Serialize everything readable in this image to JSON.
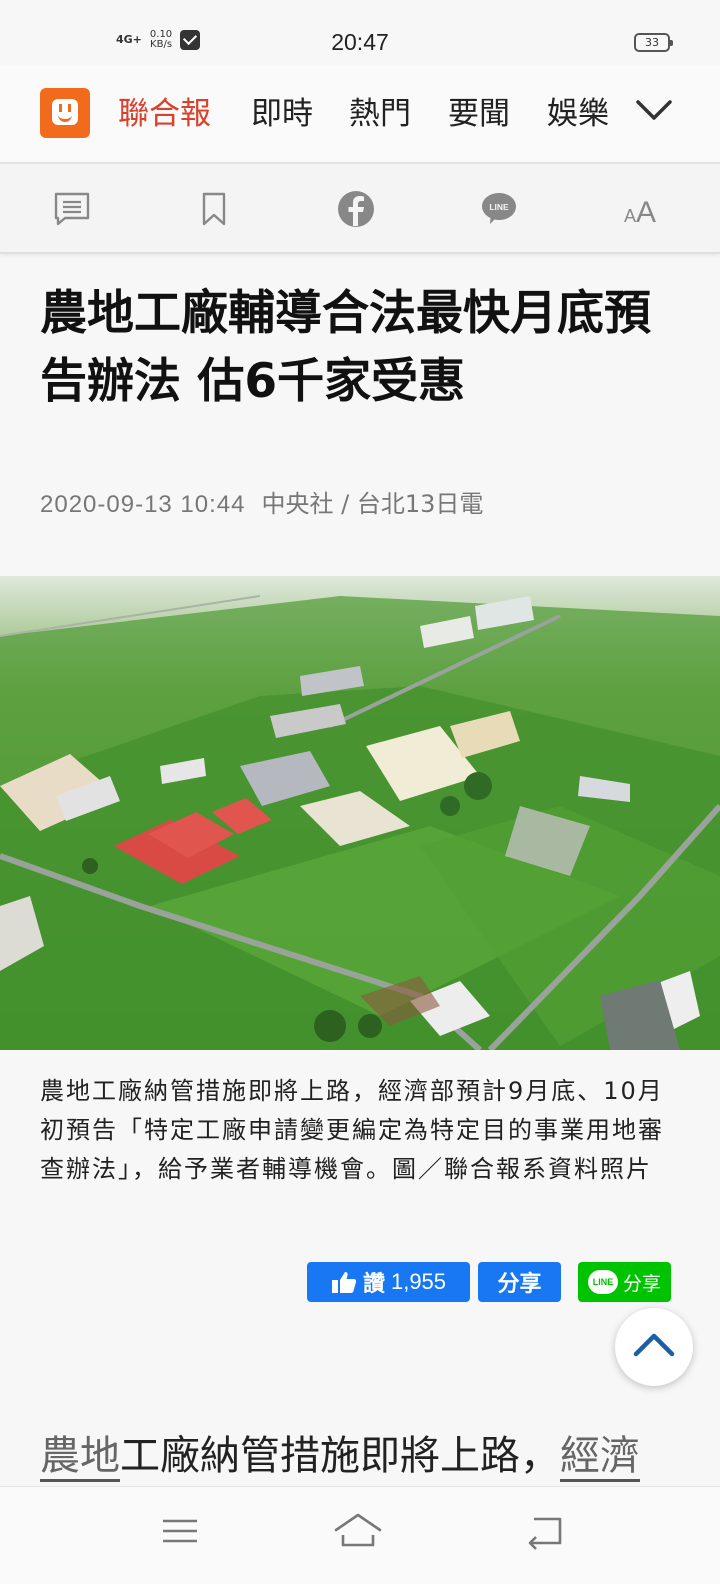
{
  "status_bar": {
    "network": "4G+",
    "speed_value": "0.10",
    "speed_unit": "KB/s",
    "time": "20:47",
    "battery": "33"
  },
  "nav": {
    "brand": "聯合報",
    "items": [
      "即時",
      "熱門",
      "要聞",
      "娛樂"
    ],
    "active_color": "#d9412c",
    "logo_color": "#f26b1d"
  },
  "toolbar": {
    "icons": [
      "comment-icon",
      "bookmark-icon",
      "facebook-icon",
      "line-icon",
      "font-size-icon"
    ],
    "line_label": "LINE",
    "font_label_small": "A",
    "font_label_large": "A"
  },
  "article": {
    "title": "農地工廠輔導合法最快月底預告辦法 估6千家受惠",
    "date": "2020-09-13 10:44",
    "source": "中央社 / 台北13日電",
    "caption": "農地工廠納管措施即將上路，經濟部預計9月底、10月初預告「特定工廠申請變更編定為特定目的事業用地審查辦法」，給予業者輔導機會。圖／聯合報系資料照片",
    "body_first_underlined": "農地",
    "body_middle": "工廠納管措施即將上路，",
    "body_last_underlined": "經濟"
  },
  "share": {
    "like_label": "讚",
    "like_count": "1,955",
    "fb_share_label": "分享",
    "line_share_label": "分享",
    "line_badge": "LINE",
    "fb_color": "#1877f2",
    "line_color": "#00c300"
  },
  "bottom_nav": {
    "icons": [
      "menu-icon",
      "home-icon",
      "back-icon"
    ]
  }
}
